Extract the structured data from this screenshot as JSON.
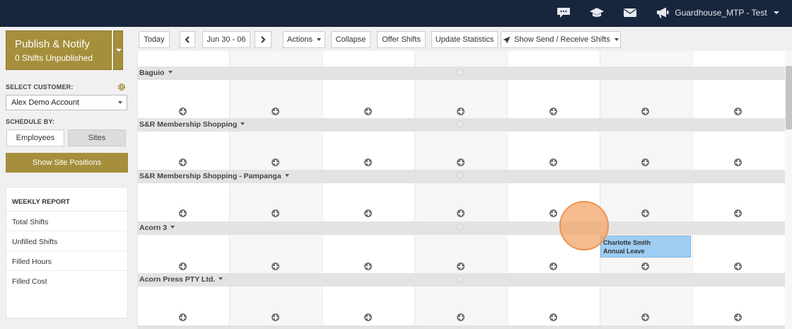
{
  "topbar": {
    "icons": [
      "chat-icon",
      "graduation-cap-icon",
      "envelope-icon",
      "megaphone-icon"
    ],
    "user_label": "Guardhouse_MTP - Test"
  },
  "sidebar": {
    "publish_title": "Publish & Notify",
    "publish_subtitle": "0 Shifts Unpublished",
    "customer_label": "SELECT CUSTOMER:",
    "customer_value": "Alex Demo Account",
    "schedule_by_label": "SCHEDULE BY:",
    "schedule_options": [
      "Employees",
      "Sites"
    ],
    "show_site_positions": "Show Site Positions",
    "report_title": "WEEKLY REPORT",
    "report_items": [
      "Total Shifts",
      "Unfilled Shifts",
      "Filled Hours",
      "Filled Cost"
    ]
  },
  "toolbar": {
    "today": "Today",
    "date_range": "Jun 30 - 06",
    "actions": "Actions",
    "collapse": "Collapse",
    "offer_shifts": "Offer Shifts",
    "update_statistics": "Update Statistics",
    "show_send_receive": "Show Send / Receive Shifts"
  },
  "schedule": {
    "sites": [
      "Baguio",
      "S&R Membership Shopping",
      "S&R Membership Shopping - Pampanga",
      "Acorn 3",
      "Acorn Press PTY Ltd."
    ],
    "shift": {
      "employee": "Charlotte Smith",
      "type": "Annual Leave"
    }
  },
  "colors": {
    "topbar": "#17253d",
    "gold": "#a68f3c",
    "shift_block": "#9ecdf3",
    "cursor": "#f3a468"
  }
}
